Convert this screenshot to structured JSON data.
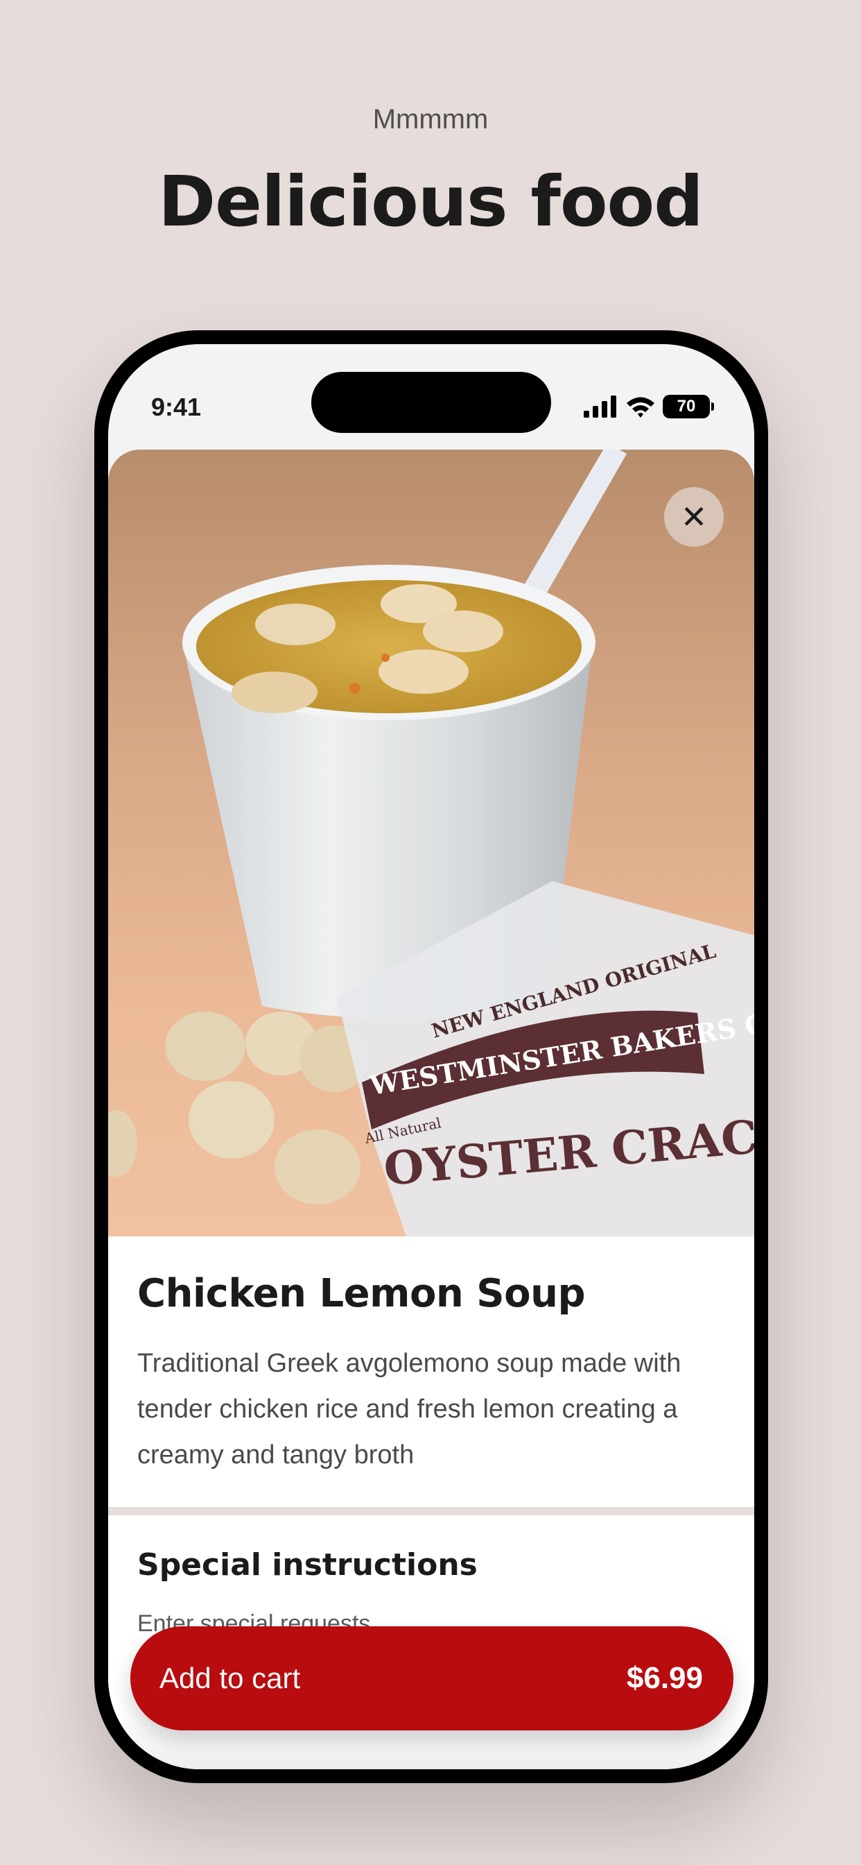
{
  "promo": {
    "kicker": "Mmmmm",
    "headline": "Delicious food"
  },
  "status_bar": {
    "time": "9:41",
    "battery": "70",
    "icons": [
      "signal-icon",
      "wifi-icon",
      "battery-icon"
    ]
  },
  "item": {
    "image": "soup-cup-with-oyster-crackers-photo",
    "pack_text": [
      "NEW ENGLAND ORIGINAL",
      "WESTMINSTER BAKERS CO",
      "All Natural",
      "OYSTER CRACKERS"
    ],
    "close_icon": "close-icon",
    "title": "Chicken Lemon Soup",
    "description": "Traditional Greek avgolemono soup made with tender chicken rice and fresh lemon creating a creamy and tangy broth"
  },
  "special_instructions": {
    "title": "Special instructions",
    "placeholder": "Enter special requests"
  },
  "cart": {
    "label": "Add to cart",
    "price": "$6.99"
  },
  "colors": {
    "background": "#e6dcda",
    "accent": "#b80c0e",
    "close_button": "#d8c5b8"
  }
}
